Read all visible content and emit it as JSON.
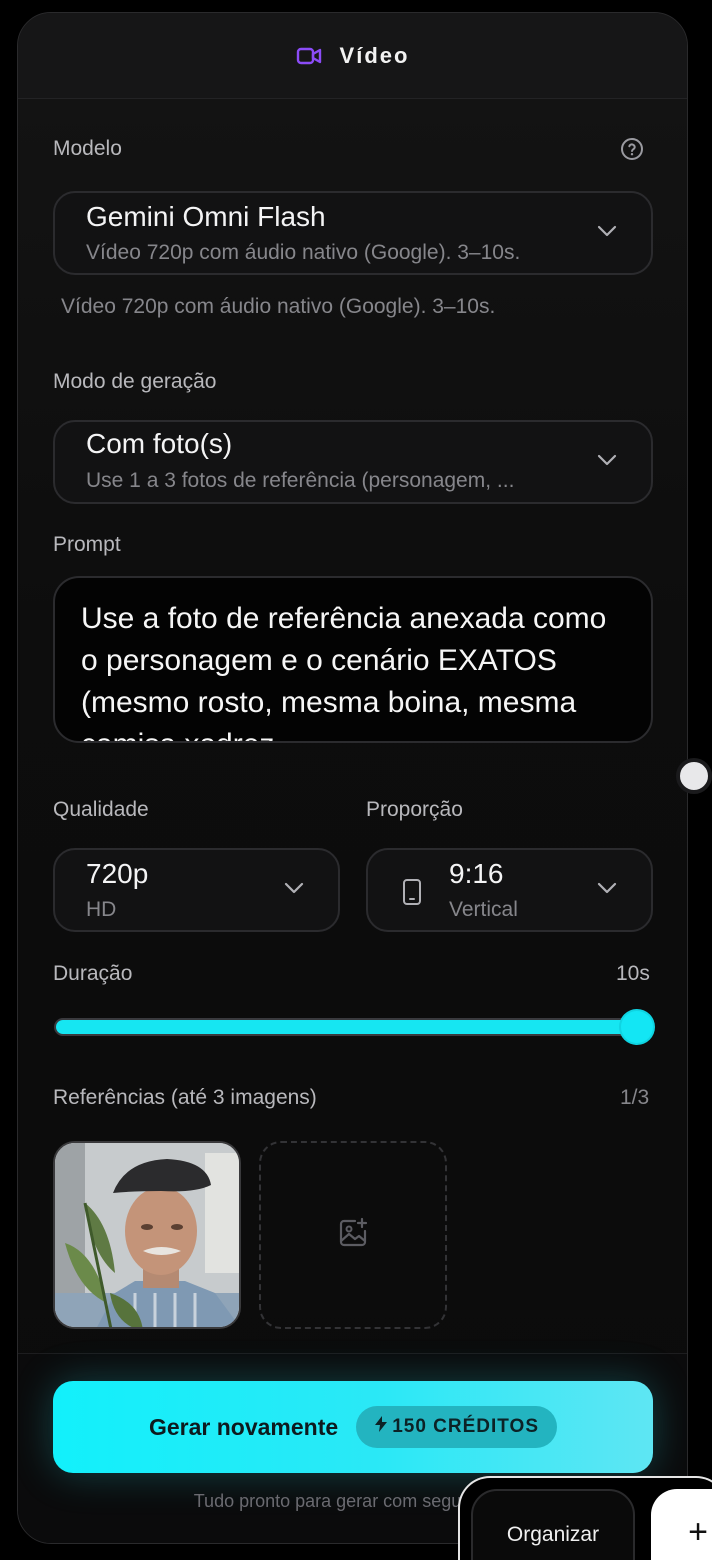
{
  "header": {
    "title": "Vídeo",
    "icon": "video-camera-icon",
    "accent": "#8b4cf7"
  },
  "model": {
    "label": "Modelo",
    "selected": "Gemini Omni Flash",
    "selected_desc": "Vídeo 720p com áudio nativo (Google). 3–10s.",
    "hint": "Vídeo 720p com áudio nativo (Google). 3–10s."
  },
  "mode": {
    "label": "Modo de geração",
    "selected": "Com foto(s)",
    "selected_desc": "Use 1 a 3 fotos de referência (personagem, ..."
  },
  "prompt": {
    "label": "Prompt",
    "value": "Use a foto de referência anexada como o personagem e o cenário EXATOS (mesmo rosto, mesma boina, mesma camisa xadrez"
  },
  "quality": {
    "label": "Qualidade",
    "selected": "720p",
    "selected_desc": "HD"
  },
  "ratio": {
    "label": "Proporção",
    "selected": "9:16",
    "selected_desc": "Vertical"
  },
  "duration": {
    "label": "Duração",
    "value_text": "10s",
    "fraction": 1.0
  },
  "references": {
    "label": "Referências (até 3 imagens)",
    "count": "1/3"
  },
  "generate": {
    "label": "Gerar novamente",
    "credits": "150 CRÉDITOS"
  },
  "status_text": "Tudo pronto para gerar com segurança.",
  "bottom_bar": {
    "organize": "Organizar",
    "add": "+"
  },
  "colors": {
    "accent_cyan": "#12f0fb",
    "panel_bg": "#0d0d0d"
  }
}
